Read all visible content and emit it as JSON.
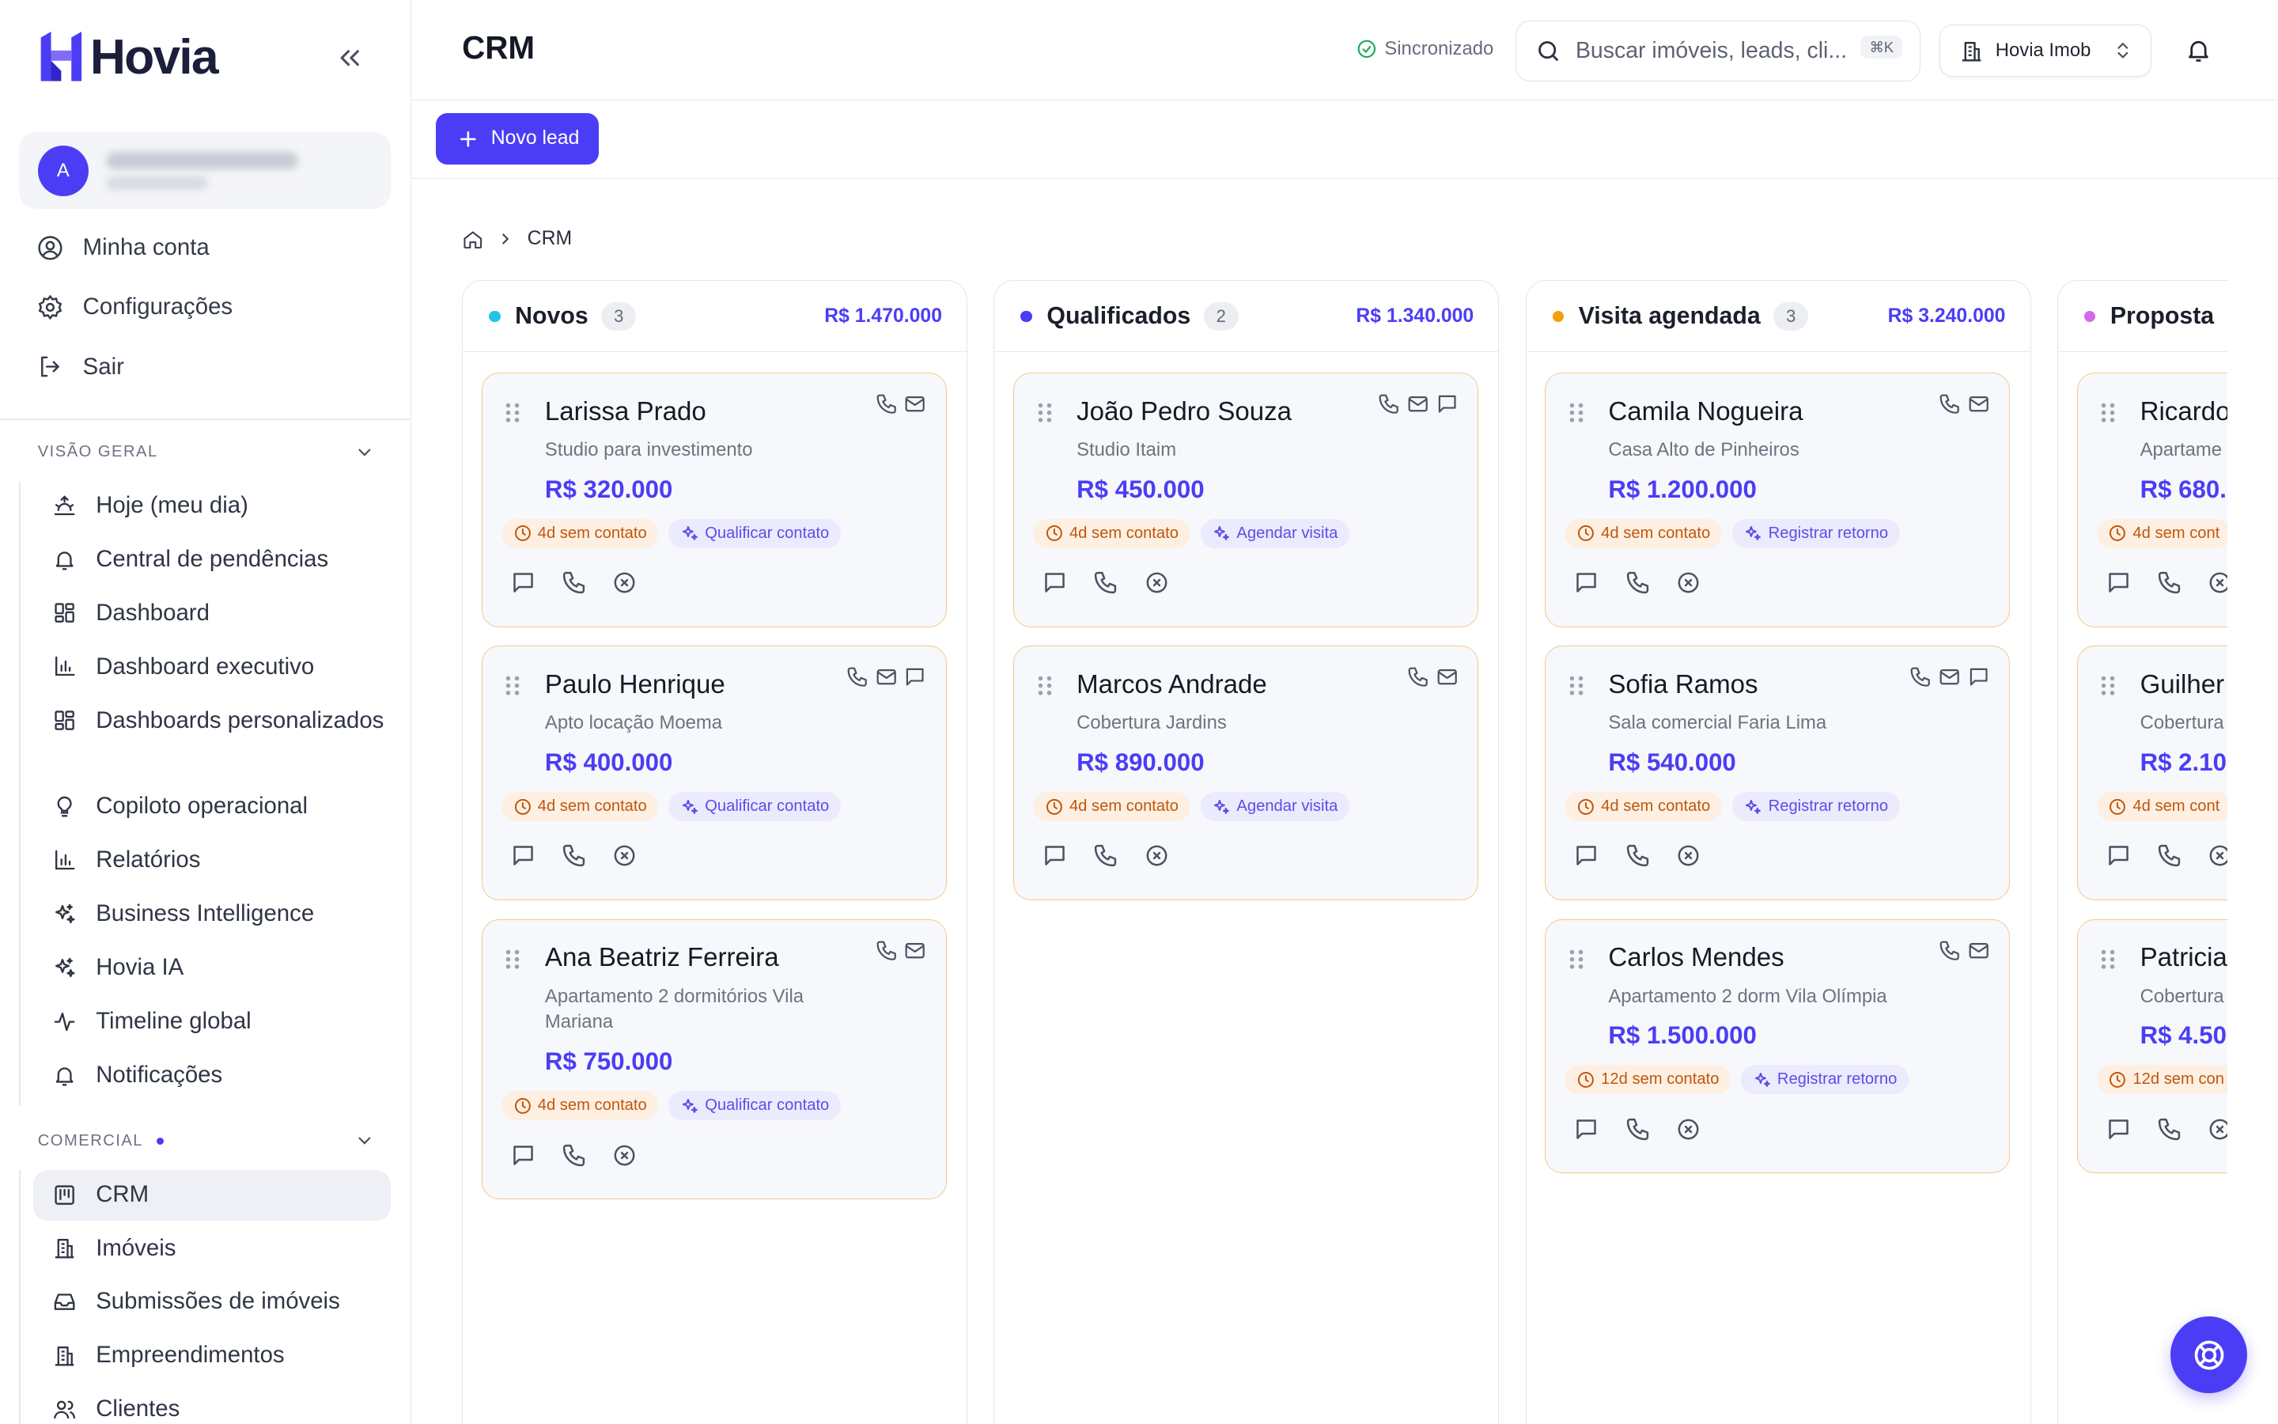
{
  "brand": {
    "name": "Hovia",
    "accent": "#4b3df6"
  },
  "user": {
    "initial": "A"
  },
  "account_menu": [
    {
      "label": "Minha conta",
      "icon": "user-circle-icon"
    },
    {
      "label": "Configurações",
      "icon": "gear-icon"
    },
    {
      "label": "Sair",
      "icon": "logout-icon"
    }
  ],
  "sections": {
    "overview": {
      "title": "VISÃO GERAL",
      "items": [
        {
          "label": "Hoje (meu dia)",
          "icon": "sunrise-icon"
        },
        {
          "label": "Central de pendências",
          "icon": "bell-icon"
        },
        {
          "label": "Dashboard",
          "icon": "grid-icon"
        },
        {
          "label": "Dashboard executivo",
          "icon": "bar-chart-icon"
        },
        {
          "label": "Dashboards personalizados",
          "icon": "grid-icon"
        },
        {
          "label": "Copiloto operacional",
          "icon": "lightbulb-icon"
        },
        {
          "label": "Relatórios",
          "icon": "bar-chart-icon"
        },
        {
          "label": "Business Intelligence",
          "icon": "sparkles-icon"
        },
        {
          "label": "Hovia IA",
          "icon": "sparkles-icon"
        },
        {
          "label": "Timeline global",
          "icon": "activity-icon"
        },
        {
          "label": "Notificações",
          "icon": "bell-icon"
        }
      ]
    },
    "commercial": {
      "title": "COMERCIAL",
      "items": [
        {
          "label": "CRM",
          "icon": "kanban-icon",
          "active": true
        },
        {
          "label": "Imóveis",
          "icon": "building-icon"
        },
        {
          "label": "Submissões de imóveis",
          "icon": "inbox-icon"
        },
        {
          "label": "Empreendimentos",
          "icon": "building-icon"
        },
        {
          "label": "Clientes",
          "icon": "users-icon"
        }
      ]
    }
  },
  "header": {
    "title": "CRM",
    "sync_status": "Sincronizado",
    "search_placeholder": "Buscar imóveis, leads, cli...",
    "search_shortcut": "⌘K",
    "org_name": "Hovia Imob"
  },
  "toolbar": {
    "new_lead_label": "Novo lead"
  },
  "breadcrumb": {
    "current": "CRM"
  },
  "columns": [
    {
      "title": "Novos",
      "count": "3",
      "total": "R$ 1.470.000",
      "dot_color": "#22c5e8",
      "cards": [
        {
          "name": "Larissa Prado",
          "property": "Studio para investimento",
          "value": "R$ 320.000",
          "status": "4d sem contato",
          "action": "Qualificar contato",
          "icons": [
            "phone",
            "mail"
          ]
        },
        {
          "name": "Paulo Henrique",
          "property": "Apto locação Moema",
          "value": "R$ 400.000",
          "status": "4d sem contato",
          "action": "Qualificar contato",
          "icons": [
            "phone",
            "mail",
            "chat"
          ]
        },
        {
          "name": "Ana Beatriz Ferreira",
          "property": "Apartamento 2 dormitórios Vila Mariana",
          "value": "R$ 750.000",
          "status": "4d sem contato",
          "action": "Qualificar contato",
          "icons": [
            "phone",
            "mail"
          ]
        }
      ]
    },
    {
      "title": "Qualificados",
      "count": "2",
      "total": "R$ 1.340.000",
      "dot_color": "#4b3df6",
      "cards": [
        {
          "name": "João Pedro Souza",
          "property": "Studio Itaim",
          "value": "R$ 450.000",
          "status": "4d sem contato",
          "action": "Agendar visita",
          "icons": [
            "phone",
            "mail",
            "chat"
          ]
        },
        {
          "name": "Marcos Andrade",
          "property": "Cobertura Jardins",
          "value": "R$ 890.000",
          "status": "4d sem contato",
          "action": "Agendar visita",
          "icons": [
            "phone",
            "mail"
          ]
        }
      ]
    },
    {
      "title": "Visita agendada",
      "count": "3",
      "total": "R$ 3.240.000",
      "dot_color": "#f59e0b",
      "cards": [
        {
          "name": "Camila Nogueira",
          "property": "Casa Alto de Pinheiros",
          "value": "R$ 1.200.000",
          "status": "4d sem contato",
          "action": "Registrar retorno",
          "icons": [
            "phone",
            "mail"
          ]
        },
        {
          "name": "Sofia Ramos",
          "property": "Sala comercial Faria Lima",
          "value": "R$ 540.000",
          "status": "4d sem contato",
          "action": "Registrar retorno",
          "icons": [
            "phone",
            "mail",
            "chat"
          ]
        },
        {
          "name": "Carlos Mendes",
          "property": "Apartamento 2 dorm Vila Olímpia",
          "value": "R$ 1.500.000",
          "status": "12d sem contato",
          "action": "Registrar retorno",
          "icons": [
            "phone",
            "mail"
          ]
        }
      ]
    },
    {
      "title": "Proposta",
      "count": "",
      "total": "",
      "dot_color": "#d26be8",
      "cards": [
        {
          "name": "Ricardo",
          "property": "Apartame",
          "value": "R$ 680.",
          "status": "4d sem cont",
          "action": "",
          "icons": []
        },
        {
          "name": "Guilher",
          "property": "Cobertura",
          "value": "R$ 2.10",
          "status": "4d sem cont",
          "action": "",
          "icons": []
        },
        {
          "name": "Patricia",
          "property": "Cobertura",
          "value": "R$ 4.50",
          "status": "12d sem con",
          "action": "",
          "icons": []
        }
      ]
    }
  ]
}
